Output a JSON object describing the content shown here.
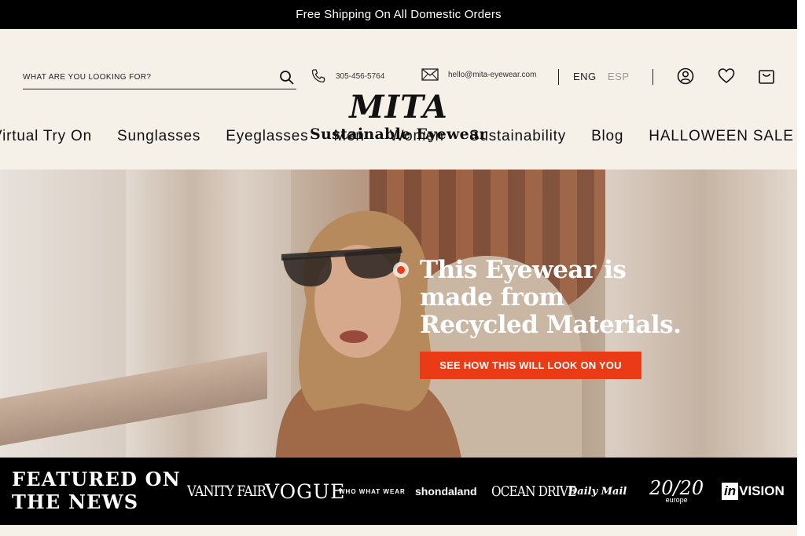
{
  "announcement": "Free Shipping On All Domestic Orders",
  "search": {
    "placeholder": "WHAT ARE YOU LOOKING FOR?"
  },
  "contact": {
    "phone": "305-456-5764",
    "email": "hello@mita-eyewear.com"
  },
  "languages": {
    "active": "ENG",
    "other": "ESP"
  },
  "logo": {
    "mark": "MITA",
    "tagline": "Sustainable Eyewear"
  },
  "nav": [
    "Virtual Try On",
    "Sunglasses",
    "Eyeglasses",
    "Men",
    "Women",
    "Sustainability",
    "Blog",
    "HALLOWEEN SALE"
  ],
  "hero": {
    "headline": "This Eyewear is made from Recycled Materials.",
    "cta": "SEE HOW THIS WILL LOOK ON YOU"
  },
  "press": {
    "title_line1": "FEATURED ON",
    "title_line2": "THE NEWS",
    "logos": {
      "vanity": "VANITY FAIR",
      "vogue": "VOGUE",
      "wwwear": "WHO WHAT WEAR",
      "shonda": "shondaland",
      "ocean": "OCEAN DRIVE",
      "daily": "Daily Mail",
      "twenty": "20/20",
      "twenty_sub": "europe",
      "invision_a": "in",
      "invision_b": "VISION"
    }
  },
  "colors": {
    "accent": "#ea3a16",
    "background": "#f5f1e8",
    "dark": "#000000"
  },
  "icons": [
    "search-icon",
    "phone-icon",
    "mail-icon",
    "account-icon",
    "heart-icon",
    "bag-icon"
  ]
}
